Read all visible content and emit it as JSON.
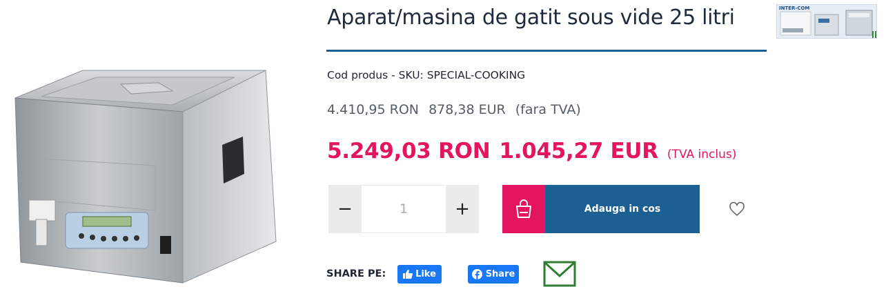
{
  "product": {
    "title": "Aparat/masina de gatit sous vide 25 litri",
    "sku_label": "Cod produs - SKU: SPECIAL-COOKING",
    "image_icon": "sous-vide-machine-image"
  },
  "price_net": {
    "ron": "4.410,95 RON",
    "eur": "878,38 EUR",
    "note": "(fara TVA)"
  },
  "price_gross": {
    "ron": "5.249,03 RON",
    "eur": "1.045,27 EUR",
    "note": "(TVA inclus)"
  },
  "quantity": {
    "minus": "−",
    "value": "1",
    "plus": "+"
  },
  "cart": {
    "label": "Adauga in cos",
    "icon": "shopping-bag-icon"
  },
  "wishlist": {
    "icon": "heart-icon"
  },
  "share": {
    "label": "SHARE PE:",
    "like": "Like",
    "share": "Share"
  },
  "banner": {
    "brand": "INTER-COM"
  },
  "colors": {
    "accent_red": "#e3155f",
    "accent_blue": "#1b5f93",
    "facebook": "#1877f2",
    "mail_green": "#2e7d32"
  }
}
